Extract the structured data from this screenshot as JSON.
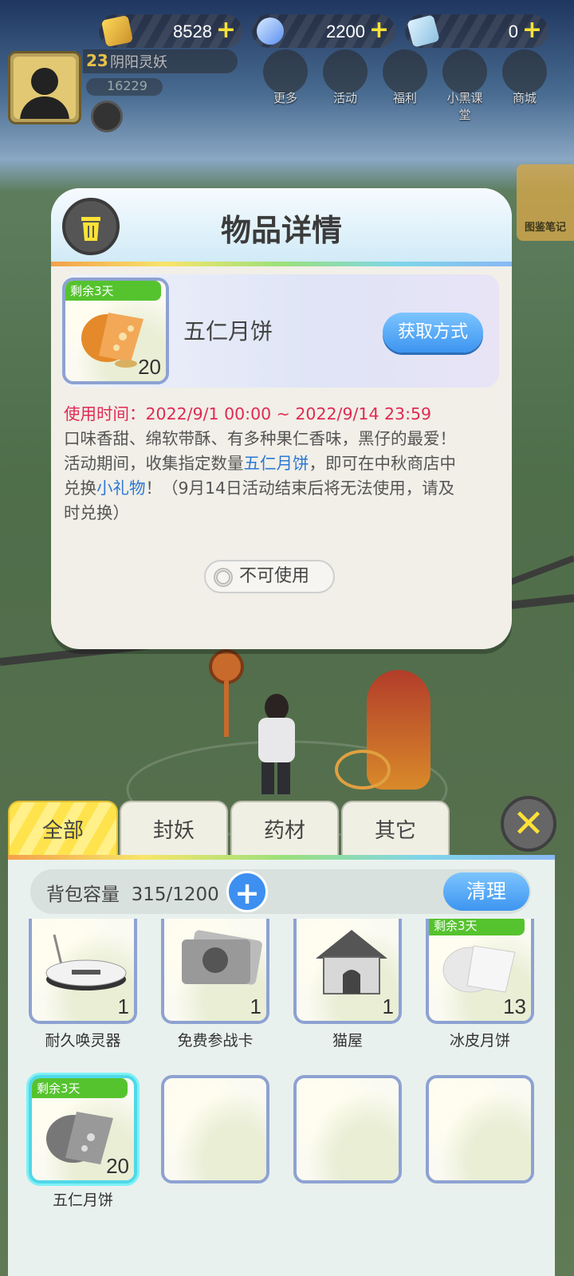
{
  "currency": {
    "gold": {
      "value": "8528",
      "icon": "gold-ingot-icon"
    },
    "diamond": {
      "value": "2200",
      "icon": "diamond-icon"
    },
    "ticket": {
      "value": "0",
      "icon": "ticket-icon"
    },
    "plus": "+"
  },
  "player": {
    "level": "23",
    "name": "阴阳灵妖",
    "power": "16229"
  },
  "top_menu": [
    {
      "label": "更多",
      "icon": "grid-icon"
    },
    {
      "label": "活动",
      "icon": "gift-icon"
    },
    {
      "label": "福利",
      "icon": "star-box-icon"
    },
    {
      "label": "小黑课堂",
      "icon": "cat-face-icon"
    },
    {
      "label": "商城",
      "icon": "shop-icon"
    }
  ],
  "side_label": "图鉴笔记",
  "dialog": {
    "title": "物品详情",
    "item_name": "五仁月饼",
    "tag": "剩余3天",
    "count": "20",
    "get_button": "获取方式",
    "time_label": "使用时间：",
    "time_value": "2022/9/1 00:00 ~ 2022/9/14 23:59",
    "desc1": "口味香甜、绵软带酥、有多种果仁香味，黑仔的最爱！",
    "desc2a": "活动期间，收集指定数量",
    "desc2_link": "五仁月饼",
    "desc2b": "，即可在中秋商店中",
    "desc3a": "兑换",
    "desc3_link": "小礼物",
    "desc3b": "！（9月14日活动结束后将无法使用，请及",
    "desc4": "时兑换）",
    "unusable": "不可使用"
  },
  "bag": {
    "tabs": [
      "全部",
      "封妖",
      "药材",
      "其它"
    ],
    "capacity_label": "背包容量",
    "capacity_value": "315/1200",
    "add": "+",
    "clean": "清理",
    "close": "✕",
    "items": [
      {
        "name": "耐久唤灵器",
        "count": "1",
        "tag": ""
      },
      {
        "name": "免费参战卡",
        "count": "1",
        "tag": ""
      },
      {
        "name": "猫屋",
        "count": "1",
        "tag": ""
      },
      {
        "name": "冰皮月饼",
        "count": "13",
        "tag": "剩余3天"
      },
      {
        "name": "五仁月饼",
        "count": "20",
        "tag": "剩余3天"
      }
    ]
  }
}
